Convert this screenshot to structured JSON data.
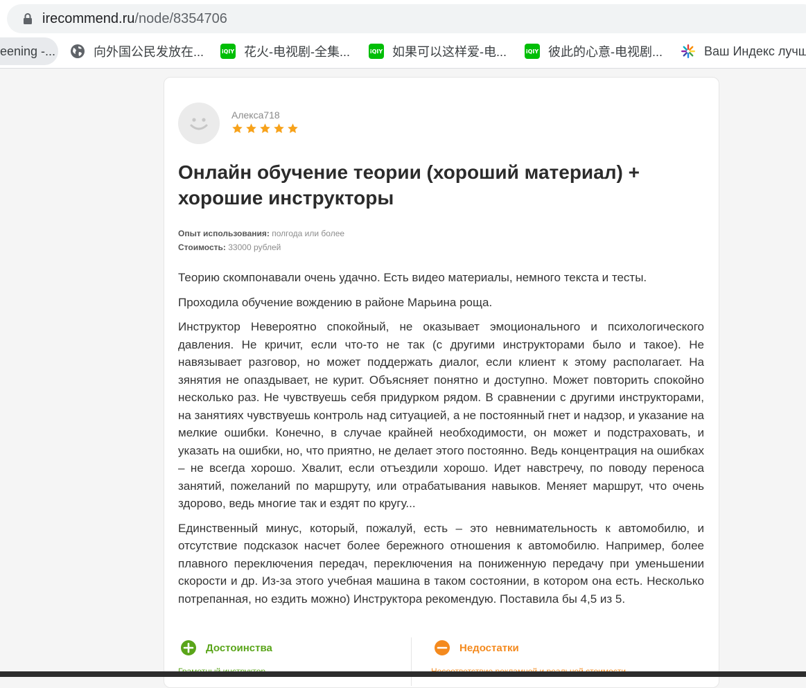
{
  "browser": {
    "url_domain": "irecommend.ru",
    "url_path": "/node/8354706",
    "bookmarks": [
      {
        "label": "eening -...",
        "icon": "none"
      },
      {
        "label": "向外国公民发放在...",
        "icon": "globe-icon"
      },
      {
        "label": "花火-电视剧-全集...",
        "icon": "iqiyi-icon"
      },
      {
        "label": "如果可以这样爱-电...",
        "icon": "iqiyi-icon"
      },
      {
        "label": "彼此的心意-电视剧...",
        "icon": "iqiyi-icon"
      },
      {
        "label": "Ваш Индекс лучш",
        "icon": "flower-icon"
      }
    ]
  },
  "review": {
    "author": "Алекса718",
    "rating": 5,
    "rating_max": 5,
    "title": "Онлайн обучение теории (хороший материал) + хорошие инструкторы",
    "experience_label": "Опыт использования:",
    "experience_value": "полгода или более",
    "cost_label": "Стоимость:",
    "cost_value": "33000 рублей",
    "paragraphs": [
      "Теорию скомпонавали очень удачно. Есть видео материалы, немного текста и тесты.",
      "Проходила обучение вождению в районе Марьина роща.",
      "Инструктор Невероятно спокойный, не оказывает эмоционального и психологического давления. Не кричит, если что-то не так (с другими инструкторами было и такое). Не навязывает разговор, но может поддержать диалог, если клиент к этому располагает. На зянятия не опаздывает, не курит. Объясняет понятно и доступно. Может повторить спокойно несколько раз. Не чувствуешь себя придурком рядом. В сравнении с другими инструкторами, на занятиях чувствуешь контроль над ситуацией, а не постоянный гнет и надзор, и указание на мелкие ошибки. Конечно, в случае крайней необходимости, он может и подстраховать, и указать на ошибки, но, что приятно, не делает этого постоянно. Ведь концентрация на ошибках – не всегда хорошо. Хвалит, если отъездили хорошо. Идет навстречу, по поводу переноса занятий, пожеланий по маршруту, или отрабатывания навыков. Меняет маршрут, что очень здорово, ведь многие так и ездят по кругу...",
      "Единственный минус, который, пожалуй, есть – это невнимательность к автомобилю, и отсутствие подсказок насчет более бережного отношения к автомобилю. Например, более плавного переключения передач, переключения на пониженную передачу при уменьшении скорости и др. Из-за этого учебная машина в таком состоянии, в котором она есть. Несколько потрепанная, но ездить можно) Инструктора рекомендую. Поставила бы 4,5 из 5."
    ],
    "pros_label": "Достоинства",
    "pros_item": "Грамотный инструктор",
    "cons_label": "Недостатки",
    "cons_item": "Несоответствие рекламной и реальной стоимости"
  },
  "colors": {
    "star": "#f7a21b",
    "pros": "#5aa51a",
    "cons": "#f48a1e",
    "text": "#333333"
  }
}
